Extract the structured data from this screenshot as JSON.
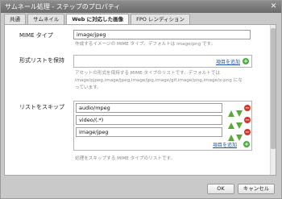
{
  "dialog": {
    "title": "サムネール処理 - ステップのプロパティ"
  },
  "tabs": [
    {
      "label": "共通"
    },
    {
      "label": "サムネイル"
    },
    {
      "label": "Web に対応した画像"
    },
    {
      "label": "FPO レンディション"
    }
  ],
  "mime_type": {
    "label": "MIME タイプ",
    "value": "image/jpeg",
    "hint": "作成するイメージの MIME タイプ。デフォルトは image/png です。"
  },
  "keep_formats": {
    "label": "形式リストを保持",
    "add_link": "項目を追加",
    "hint": "アセットの形式を保持する MIME タイプのリストです。デフォルトでは image/pjpeg,image/jpeg,image/jpg,image/gif,image/png,image/x-png になっています。"
  },
  "skip_list": {
    "label": "リストをスキップ",
    "items": [
      "audio/mpeg",
      "video/(.*)",
      "image/jpeg"
    ],
    "add_link": "項目を追加",
    "hint": "処理をスキップする MIME タイプのリストです。"
  },
  "footer": {
    "ok_label": "OK",
    "cancel_label": "キャンセル"
  },
  "colors": {
    "add": "#4caa3f",
    "remove": "#d9342b",
    "move": "#5aa83a"
  }
}
